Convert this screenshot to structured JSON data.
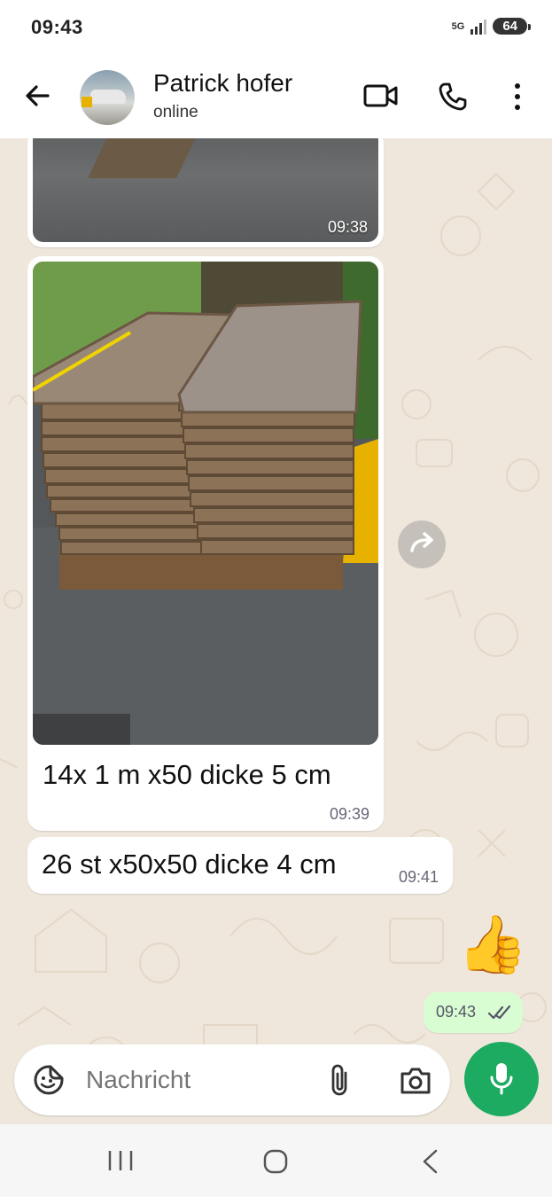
{
  "status_bar": {
    "time": "09:43",
    "network": "5G",
    "battery": "64"
  },
  "header": {
    "contact_name": "Patrick hofer",
    "presence": "online"
  },
  "messages": [
    {
      "type": "image",
      "timestamp": "09:38"
    },
    {
      "type": "image",
      "caption": "14x 1 m x50 dicke 5 cm",
      "timestamp": "09:39"
    },
    {
      "type": "text",
      "text": "26 st x50x50 dicke 4 cm",
      "timestamp": "09:41"
    },
    {
      "type": "emoji",
      "emoji": "👍"
    },
    {
      "type": "outgoing-time",
      "timestamp": "09:43",
      "read_status": "read"
    }
  ],
  "composer": {
    "placeholder": "Nachricht"
  },
  "colors": {
    "accent": "#1daa61",
    "chat_background": "#efe7dc",
    "outgoing_bubble": "#d9fdd3"
  },
  "icons": [
    "back-arrow-icon",
    "video-call-icon",
    "voice-call-icon",
    "more-options-icon",
    "forward-icon",
    "sticker-icon",
    "attach-icon",
    "camera-icon",
    "mic-icon",
    "double-check-icon",
    "recents-icon",
    "home-icon",
    "nav-back-icon"
  ]
}
